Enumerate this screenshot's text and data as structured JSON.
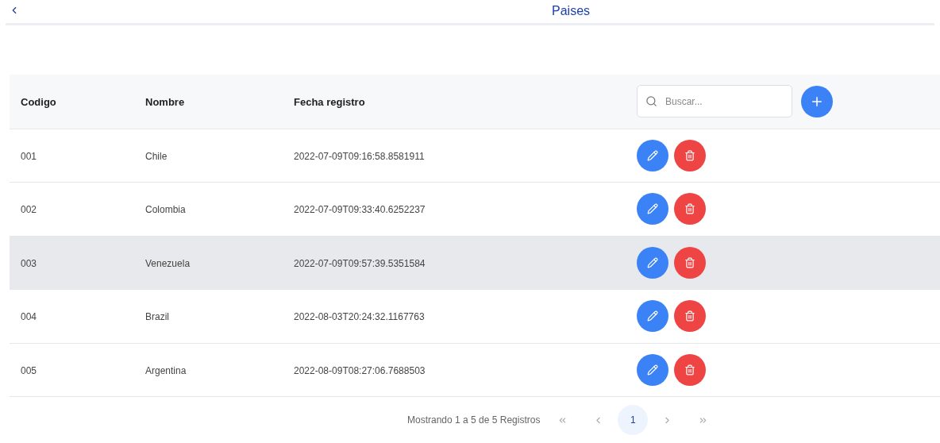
{
  "header": {
    "title": "Paises"
  },
  "table": {
    "columns": [
      "Codigo",
      "Nombre",
      "Fecha registro"
    ],
    "search": {
      "placeholder": "Buscar..."
    },
    "rows": [
      {
        "cells": [
          "001",
          "Chile",
          "2022-07-09T09:16:58.8581911"
        ],
        "selected": false
      },
      {
        "cells": [
          "002",
          "Colombia",
          "2022-07-09T09:33:40.6252237"
        ],
        "selected": false
      },
      {
        "cells": [
          "003",
          "Venezuela",
          "2022-07-09T09:57:39.5351584"
        ],
        "selected": true
      },
      {
        "cells": [
          "004",
          "Brazil",
          "2022-08-03T20:24:32.1167763"
        ],
        "selected": false
      },
      {
        "cells": [
          "005",
          "Argentina",
          "2022-08-09T08:27:06.7688503"
        ],
        "selected": false
      }
    ]
  },
  "pagination": {
    "summary": "Mostrando 1 a 5 de 5 Registros",
    "pages": [
      {
        "label": "1",
        "selected": true
      }
    ]
  }
}
